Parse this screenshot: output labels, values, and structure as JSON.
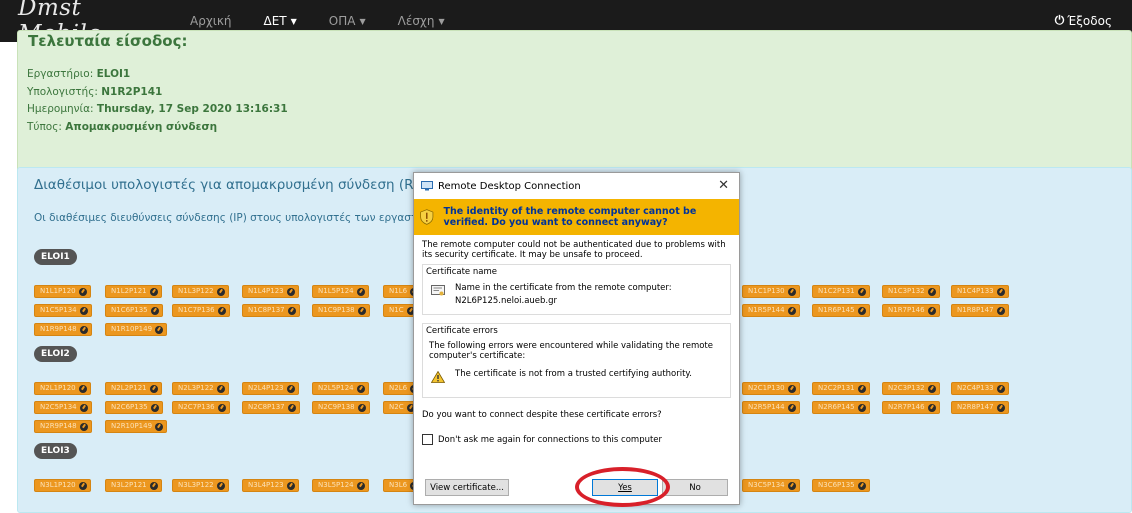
{
  "navbar": {
    "brand": "Dmst Mobile",
    "items": [
      {
        "label": "Αρχική",
        "active": false,
        "dropdown": false
      },
      {
        "label": "ΔΕΤ",
        "active": true,
        "dropdown": true
      },
      {
        "label": "ΟΠΑ",
        "active": false,
        "dropdown": true
      },
      {
        "label": "Λέσχη",
        "active": false,
        "dropdown": true
      }
    ],
    "logout": "Έξοδος",
    "caret": "▼",
    "power_icon": "⏻"
  },
  "last_login": {
    "title": "Τελευταία είσοδος:",
    "lab_label": "Εργαστήριο:",
    "lab_value": "ELOI1",
    "pc_label": "Υπολογιστής:",
    "pc_value": "N1R2P141",
    "date_label": "Ημερομηνία:",
    "date_value": "Thursday, 17 Sep 2020 13:16:31",
    "type_label": "Τύπος:",
    "type_value": "Απομακρυσμένη σύνδεση"
  },
  "available": {
    "title": "Διαθέσιμοι υπολογιστές για απομακρυσμένη σύνδεση (R",
    "subtitle": "Οι διαθέσιμες διευθύνσεις σύνδεσης (IP) στους υπολογιστές των εργαστ"
  },
  "labs": [
    {
      "name": "ELOI1",
      "row1_left": [
        "N1L1P120",
        "N1L2P121",
        "N1L3P122",
        "N1L4P123",
        "N1L5P124",
        "N1L6"
      ],
      "row1_right": [
        "N1C1P130",
        "N1C2P131",
        "N1C3P132",
        "N1C4P133"
      ],
      "row2_left": [
        "N1C5P134",
        "N1C6P135",
        "N1C7P136",
        "N1C8P137",
        "N1C9P138",
        "N1C"
      ],
      "row2_right": [
        "N1R5P144",
        "N1R6P145",
        "N1R7P146",
        "N1R8P147"
      ],
      "row3_left": [
        "N1R9P148",
        "N1R10P149"
      ]
    },
    {
      "name": "ELOI2",
      "row1_left": [
        "N2L1P120",
        "N2L2P121",
        "N2L3P122",
        "N2L4P123",
        "N2L5P124",
        "N2L6"
      ],
      "row1_right": [
        "N2C1P130",
        "N2C2P131",
        "N2C3P132",
        "N2C4P133"
      ],
      "row2_left": [
        "N2C5P134",
        "N2C6P135",
        "N2C7P136",
        "N2C8P137",
        "N2C9P138",
        "N2C"
      ],
      "row2_right": [
        "N2R5P144",
        "N2R6P145",
        "N2R7P146",
        "N2R8P147"
      ],
      "row3_left": [
        "N2R9P148",
        "N2R10P149"
      ]
    },
    {
      "name": "ELOI3",
      "row1_left": [
        "N3L1P120",
        "N3L2P121",
        "N3L3P122",
        "N3L4P123",
        "N3L5P124",
        "N3L6"
      ],
      "row1_right": [
        "N3C5P134",
        "N3C6P135"
      ]
    }
  ],
  "dialog": {
    "title": "Remote Desktop Connection",
    "close": "✕",
    "warning": "The identity of the remote computer cannot be verified. Do you want to connect anyway?",
    "intro": "The remote computer could not be authenticated due to problems with its security certificate. It may be unsafe to proceed.",
    "cert_name_title": "Certificate name",
    "cert_name_text": "Name in the certificate from the remote computer:",
    "cert_host": "N2L6P125.neloi.aueb.gr",
    "cert_errors_title": "Certificate errors",
    "cert_errors_text": "The following errors were encountered while validating the remote computer's certificate:",
    "cert_error_item": "The certificate is not from a trusted certifying authority.",
    "question": "Do you want to connect despite these certificate errors?",
    "checkbox_label": "Don't ask me again for connections to this computer",
    "view_cert": "View certificate...",
    "yes": "Yes",
    "no": "No"
  },
  "colors": {
    "navbar": "#1b1b1b",
    "green_panel": "#dff0d8",
    "blue_panel": "#d9edf7",
    "button": "#ec971f",
    "warning_bar": "#f4b400",
    "highlight_oval": "#d8202a"
  }
}
